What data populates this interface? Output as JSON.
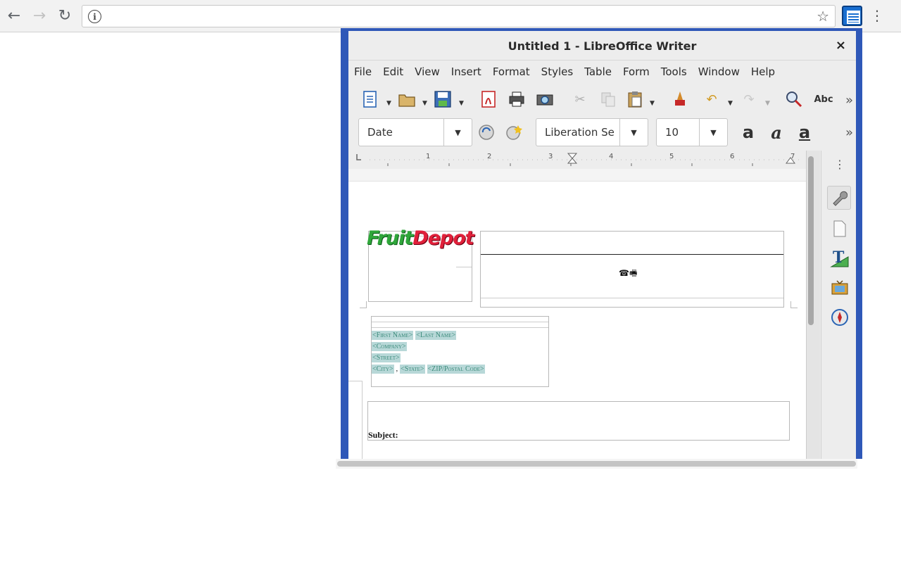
{
  "browser": {
    "back_icon": "←",
    "forward_icon": "→",
    "reload_icon": "↻",
    "info_icon": "i",
    "star_icon": "☆",
    "menu_icon": "⋮"
  },
  "window": {
    "title": "Untitled 1 - LibreOffice Writer",
    "close_icon": "×"
  },
  "menubar": [
    "File",
    "Edit",
    "View",
    "Insert",
    "Format",
    "Styles",
    "Table",
    "Form",
    "Tools",
    "Window",
    "Help"
  ],
  "formatting": {
    "paragraph_style": "Date",
    "font_name": "Liberation Se",
    "font_size": "10",
    "more_icon": "»"
  },
  "ruler": {
    "numbers": [
      "1",
      "2",
      "3",
      "4",
      "5",
      "6",
      "7"
    ]
  },
  "document": {
    "logo": {
      "part1": "Fruit",
      "part2": "Depot"
    },
    "phone_icons": "☎🖷",
    "address_fields": {
      "first_name": "<First Name>",
      "last_name": "<Last Name>",
      "company": "<Company>",
      "street": "<Street>",
      "city": "<City>",
      "separator": ",",
      "state": "<State>",
      "zip": "<ZIP/Postal Code>"
    },
    "subject_label": "Subject:"
  },
  "colors": {
    "window_frame": "#2f58b8",
    "field_highlight": "#b8d8d8",
    "field_text": "#3a8a7a"
  }
}
